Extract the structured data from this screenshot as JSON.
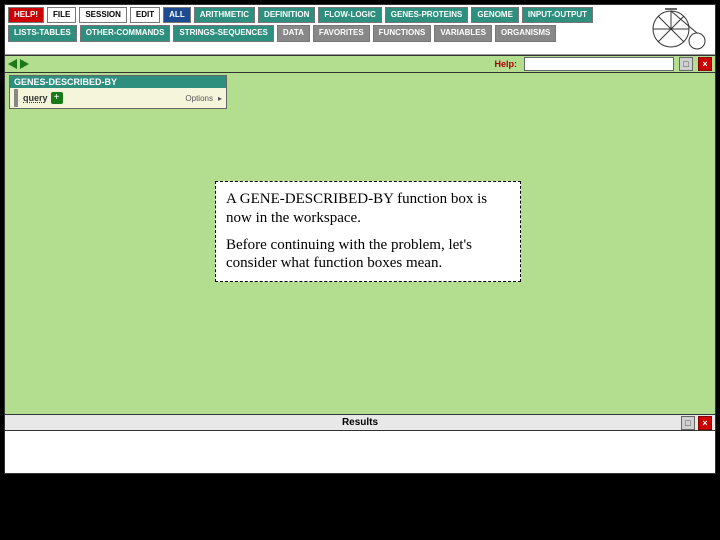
{
  "menubar": {
    "row1": [
      {
        "label": "HELP!",
        "cls": "red"
      },
      {
        "label": "FILE",
        "cls": ""
      },
      {
        "label": "SESSION",
        "cls": ""
      },
      {
        "label": "EDIT",
        "cls": ""
      },
      {
        "label": "ALL",
        "cls": "navy"
      },
      {
        "label": "ARITHMETIC",
        "cls": "teal"
      },
      {
        "label": "DEFINITION",
        "cls": "teal"
      },
      {
        "label": "FLOW-LOGIC",
        "cls": "teal"
      },
      {
        "label": "GENES-PROTEINS",
        "cls": "teal"
      },
      {
        "label": "GENOME",
        "cls": "teal"
      },
      {
        "label": "INPUT-OUTPUT",
        "cls": "teal"
      }
    ],
    "row2": [
      {
        "label": "LISTS-TABLES",
        "cls": "teal"
      },
      {
        "label": "OTHER-COMMANDS",
        "cls": "teal"
      },
      {
        "label": "STRINGS-SEQUENCES",
        "cls": "teal"
      },
      {
        "label": "DATA",
        "cls": "grey"
      },
      {
        "label": "FAVORITES",
        "cls": "grey"
      },
      {
        "label": "FUNCTIONS",
        "cls": "grey"
      },
      {
        "label": "VARIABLES",
        "cls": "grey"
      },
      {
        "label": "ORGANISMS",
        "cls": "grey"
      }
    ]
  },
  "toolbar": {
    "help_label": "Help:",
    "help_value": ""
  },
  "funcbox": {
    "title": "GENES-DESCRIBED-BY",
    "field": "query",
    "options": "Options"
  },
  "tutorial": {
    "p1": "A GENE-DESCRIBED-BY function box is now in the workspace.",
    "p2": "Before continuing with the problem, let's consider what function boxes mean."
  },
  "results": {
    "title": "Results"
  }
}
